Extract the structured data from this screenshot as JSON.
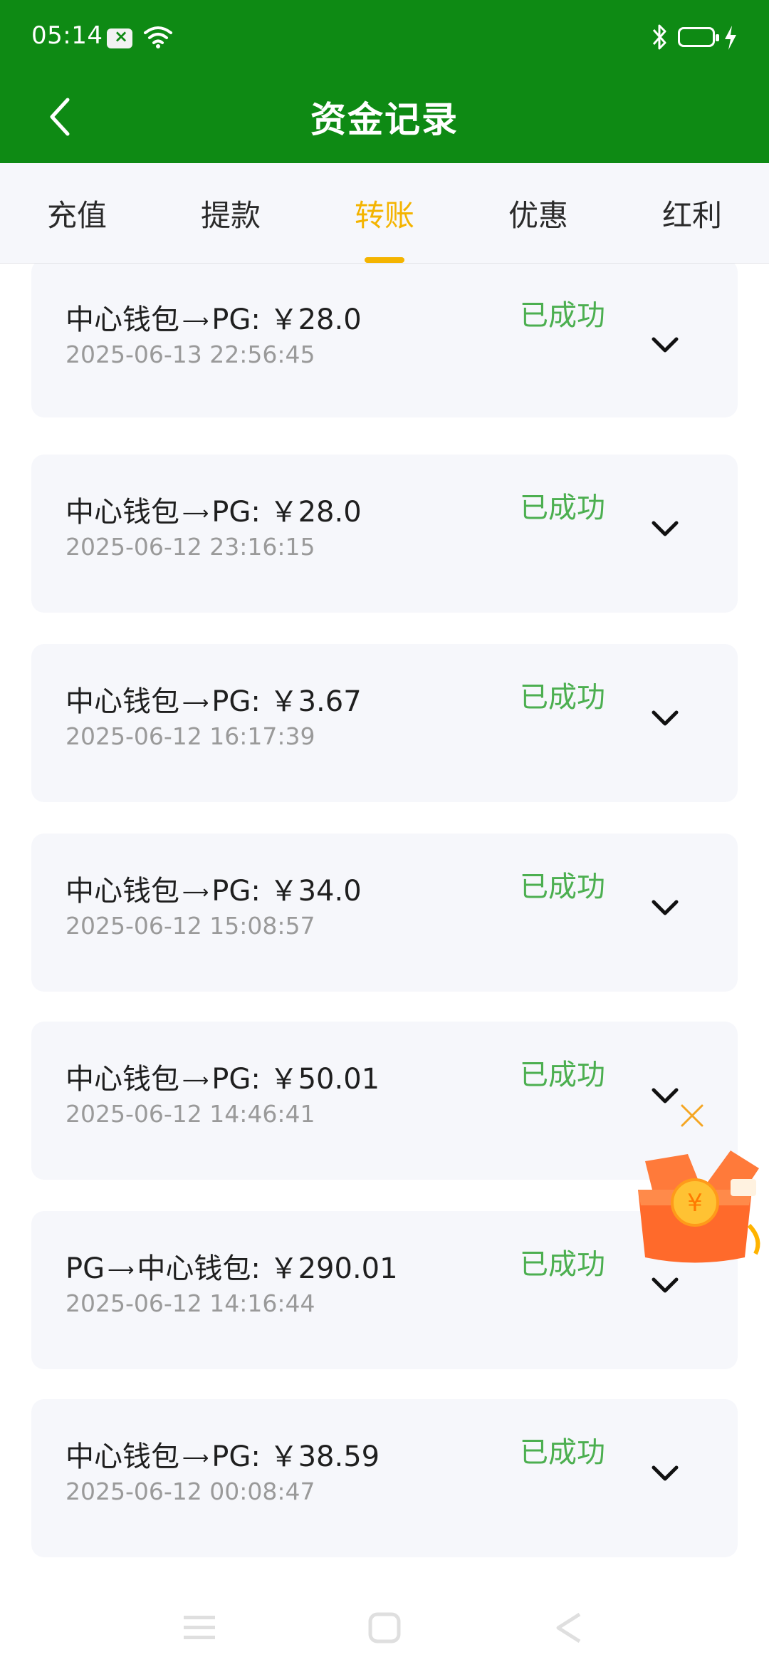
{
  "status_bar": {
    "time": "05:14"
  },
  "header": {
    "title": "资金记录",
    "back_icon": "chevron-left-icon"
  },
  "tabs": [
    {
      "label": "充值",
      "active": false
    },
    {
      "label": "提款",
      "active": false
    },
    {
      "label": "转账",
      "active": true
    },
    {
      "label": "优惠",
      "active": false
    },
    {
      "label": "红利",
      "active": false
    }
  ],
  "records": [
    {
      "from": "中心钱包",
      "to": "PG",
      "amount": "￥28.0",
      "time": "2025-06-13 22:56:45",
      "status": "已成功"
    },
    {
      "from": "中心钱包",
      "to": "PG",
      "amount": "￥28.0",
      "time": "2025-06-12 23:16:15",
      "status": "已成功"
    },
    {
      "from": "中心钱包",
      "to": "PG",
      "amount": "￥3.67",
      "time": "2025-06-12 16:17:39",
      "status": "已成功"
    },
    {
      "from": "中心钱包",
      "to": "PG",
      "amount": "￥34.0",
      "time": "2025-06-12 15:08:57",
      "status": "已成功"
    },
    {
      "from": "中心钱包",
      "to": "PG",
      "amount": "￥50.01",
      "time": "2025-06-12 14:46:41",
      "status": "已成功"
    },
    {
      "from": "PG",
      "to": "中心钱包",
      "amount": "￥290.01",
      "time": "2025-06-12 14:16:44",
      "status": "已成功"
    },
    {
      "from": "中心钱包",
      "to": "PG",
      "amount": "￥38.59",
      "time": "2025-06-12 00:08:47",
      "status": "已成功"
    }
  ],
  "colors": {
    "header_bg": "#0e8a14",
    "active_tab": "#f4b400",
    "success": "#4caf50",
    "card_bg": "#f6f7fb"
  }
}
